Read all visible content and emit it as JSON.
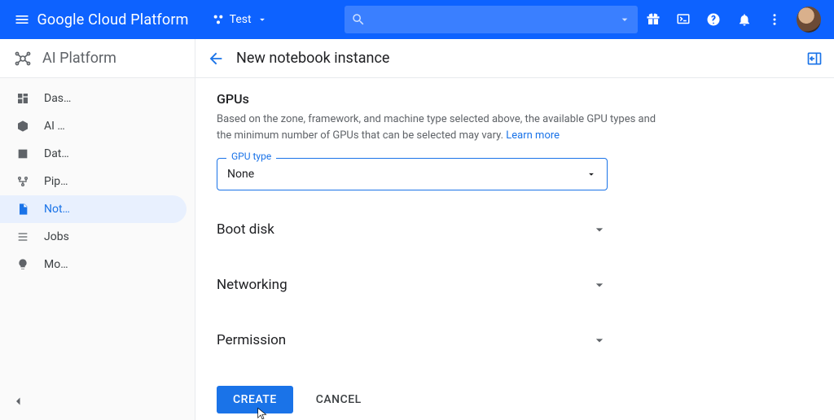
{
  "header": {
    "brand": "Google Cloud Platform",
    "project": "Test"
  },
  "sidebar": {
    "title": "AI Platform",
    "items": [
      {
        "label": "Das…"
      },
      {
        "label": "AI …"
      },
      {
        "label": "Dat…"
      },
      {
        "label": "Pip…"
      },
      {
        "label": "Not…"
      },
      {
        "label": "Jobs"
      },
      {
        "label": "Mo…"
      }
    ]
  },
  "page": {
    "title": "New notebook instance",
    "gpu": {
      "heading": "GPUs",
      "help": "Based on the zone, framework, and machine type selected above, the available GPU types and the minimum number of GPUs that can be selected may vary.",
      "learn_more": "Learn more",
      "field_label": "GPU type",
      "field_value": "None"
    },
    "sections": {
      "boot_disk": "Boot disk",
      "networking": "Networking",
      "permission": "Permission"
    },
    "actions": {
      "create": "CREATE",
      "cancel": "CANCEL"
    }
  }
}
